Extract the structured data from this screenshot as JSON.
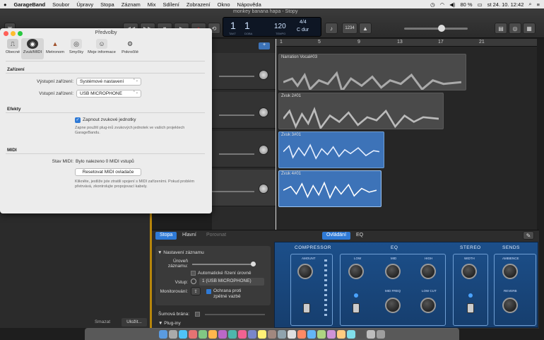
{
  "menubar": {
    "apple": "",
    "app": "GarageBand",
    "items": [
      "Soubor",
      "Úpravy",
      "Stopa",
      "Záznam",
      "Mix",
      "Sdílení",
      "Zobrazení",
      "Okno",
      "Nápověda"
    ],
    "battery": "80 %",
    "datetime": "st 24. 10.  12:42"
  },
  "window": {
    "title": "monkey banana hapa - Stopy"
  },
  "lcd": {
    "bar": "1",
    "beat": "1",
    "bar_label": "TAKT",
    "beat_label": "DOBA",
    "tempo": "120",
    "tempo_label": "TEMPO",
    "signature": "4/4",
    "key": "C dur",
    "count_in": "1234"
  },
  "ruler": {
    "marks": [
      "1",
      "5",
      "9",
      "13",
      "17",
      "21"
    ]
  },
  "regions": [
    {
      "name": "Narration Vocal#03"
    },
    {
      "name": "Zvuk 2#01"
    },
    {
      "name": "Zvuk 3#01"
    },
    {
      "name": "Zvuk 4#01"
    }
  ],
  "prefs": {
    "title": "Předvolby",
    "tabs": [
      "Obecné",
      "Zvuk/MIDI",
      "Metronom",
      "Smyčky",
      "Moje informace",
      "Pokročilé"
    ],
    "devices_header": "Zařízení",
    "output_label": "Výstupní zařízení:",
    "output_value": "Systémové nastavení",
    "input_label": "Vstupní zařízení:",
    "input_value": "USB MICROPHONE",
    "effects_header": "Efekty",
    "effects_checkbox": "Zapnout zvukové jednotky",
    "effects_note": "Zapne použití plug-inů zvukových jednotek ve vašich projektech GarageBandu.",
    "midi_header": "MIDI",
    "midi_status_label": "Stav MIDI:",
    "midi_status_value": "Bylo nalezeno 0 MIDI vstupů",
    "midi_reset": "Resetovat MIDI ovladače",
    "midi_note": "Klikněte, jestliže jste ztratili spojení s MIDI zařízeními. Pokud problém přetrvává, zkontrolujte propojovací kabely."
  },
  "library_buttons": {
    "delete": "Smazat",
    "save": "Uložit..."
  },
  "lower": {
    "tabs_left": [
      "Stopa",
      "Hlavní",
      "Porovnat"
    ],
    "tabs_right": [
      "Ovládání",
      "EQ"
    ],
    "record_header": "Nastavení záznamu",
    "level_label": "Úroveň záznamu:",
    "auto_level": "Automatické řízení úrovně",
    "input_label": "Vstup:",
    "input_value": "1 (USB MICROPHONE)",
    "monitor_label": "Monitorování:",
    "feedback": "Ochrana proti zpětné vazbě",
    "noise_gate": "Šumová brána:",
    "plugins": "Plug-iny"
  },
  "plugin": {
    "sections": [
      "COMPRESSOR",
      "EQ",
      "STEREO",
      "SENDS"
    ],
    "knobs": [
      "AMOUNT",
      "LOW",
      "MID",
      "HIGH",
      "MID FREQ",
      "LOW CUT",
      "WIDTH",
      "AMBIENCE",
      "REVERB"
    ]
  },
  "colors": {
    "accent": "#2f7ad6",
    "plugin_bg": "#1c4f8a",
    "region_blue": "#3d73b8",
    "region_gray": "#4a4a4a"
  }
}
